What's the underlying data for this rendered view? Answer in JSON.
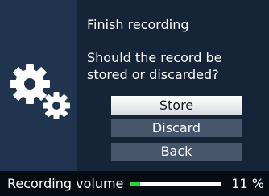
{
  "dialog": {
    "title": "Finish recording",
    "message": "Should the record be stored or discarded?",
    "buttons": {
      "store": "Store",
      "discard": "Discard",
      "back": "Back"
    },
    "icon": "gears-icon",
    "selected_button": "store"
  },
  "status": {
    "label": "Recording volume",
    "value_text": "11 %",
    "level": 0.11
  },
  "colors": {
    "background": "#1b2c42",
    "selected_button": "#ffffff",
    "button": "#46566d",
    "level_fill": "#2bd13a",
    "status_bar": "#070b12"
  }
}
